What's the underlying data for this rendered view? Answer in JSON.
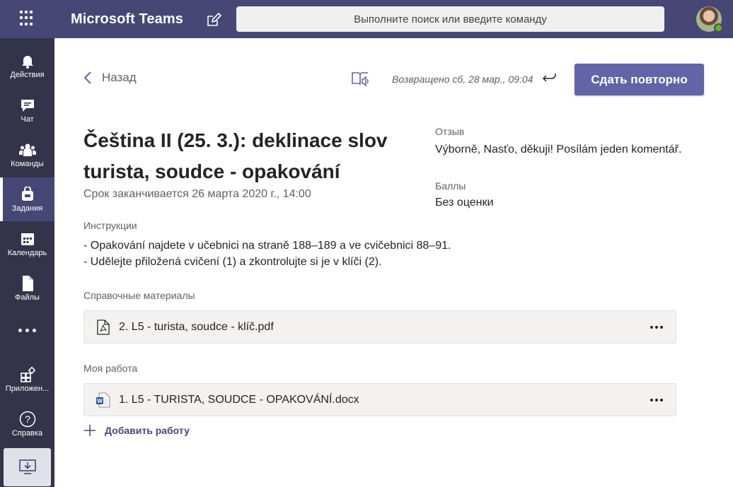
{
  "app": {
    "title": "Microsoft Teams"
  },
  "search": {
    "placeholder": "Выполните поиск или введите команду"
  },
  "colors": {
    "topbar": "#464775",
    "rail": "#33344a",
    "accent": "#6264a7",
    "presence": "#6bb700"
  },
  "rail": {
    "items": [
      {
        "label": "Действия",
        "icon": "bell-icon"
      },
      {
        "label": "Чат",
        "icon": "chat-icon"
      },
      {
        "label": "Команды",
        "icon": "teams-icon"
      },
      {
        "label": "Задания",
        "icon": "assignments-icon",
        "active": true
      },
      {
        "label": "Календарь",
        "icon": "calendar-icon"
      },
      {
        "label": "Файлы",
        "icon": "files-icon"
      },
      {
        "label": "Приложен...",
        "icon": "apps-icon"
      },
      {
        "label": "Справка",
        "icon": "help-icon"
      }
    ]
  },
  "header": {
    "back_label": "Назад",
    "returned_text": "Возвращено сб, 28 мар., 09:04",
    "resubmit_label": "Сдать повторно"
  },
  "assignment": {
    "title": "Čeština II (25. 3.): deklinace slov turista, soudce - opakování",
    "due": "Срок заканчивается 26 марта 2020 г., 14:00",
    "feedback_label": "Отзыв",
    "feedback": "Výborně, Nasťo, děkuji! Posílám jeden komentář.",
    "points_label": "Баллы",
    "points": "Без оценки",
    "instructions_label": "Инструкции",
    "instructions": [
      "- Opakování najdete v učebnici na straně 188–189 a ve cvičebnici 88–91.",
      "- Udělejte přiložená cvičení (1) a zkontrolujte si je v klíči (2)."
    ],
    "reference_label": "Справочные материалы",
    "reference_files": [
      {
        "name": "2. L5 - turista, soudce - klíč.pdf",
        "icon": "pdf-icon"
      }
    ],
    "my_work_label": "Моя работа",
    "my_work_files": [
      {
        "name": "1. L5 - TURISTA, SOUDCE - OPAKOVÁNÍ.docx",
        "icon": "word-icon"
      }
    ],
    "add_work_label": "Добавить работу"
  }
}
